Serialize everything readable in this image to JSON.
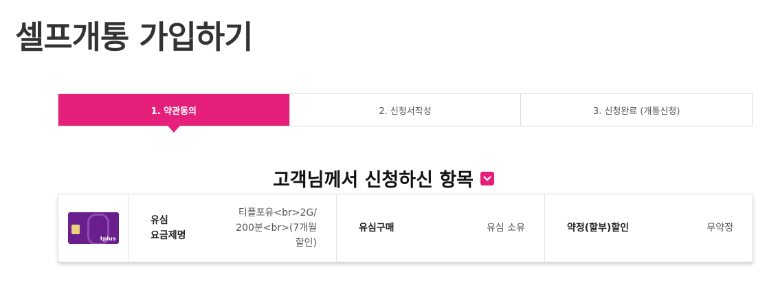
{
  "page": {
    "title": "셀프개통 가입하기"
  },
  "steps": [
    {
      "label": "1. 약관동의",
      "active": true
    },
    {
      "label": "2. 신청서작성",
      "active": false
    },
    {
      "label": "3. 신청완료 (개통신청)",
      "active": false
    }
  ],
  "summary": {
    "title": "고객님께서 신청하신 항목",
    "toggle_icon": "chevron-down-icon",
    "items": [
      {
        "label": "유심\n요금제명",
        "value": "티플포유<br>2G/200분<br>(7개월할인)"
      },
      {
        "label": "유심구매",
        "value": "유심 소유"
      },
      {
        "label": "약정(할부)할인",
        "value": "무약정"
      }
    ],
    "sim_brand": "tplus"
  },
  "colors": {
    "accent": "#e6207a",
    "sim": "#6b1f8c"
  }
}
